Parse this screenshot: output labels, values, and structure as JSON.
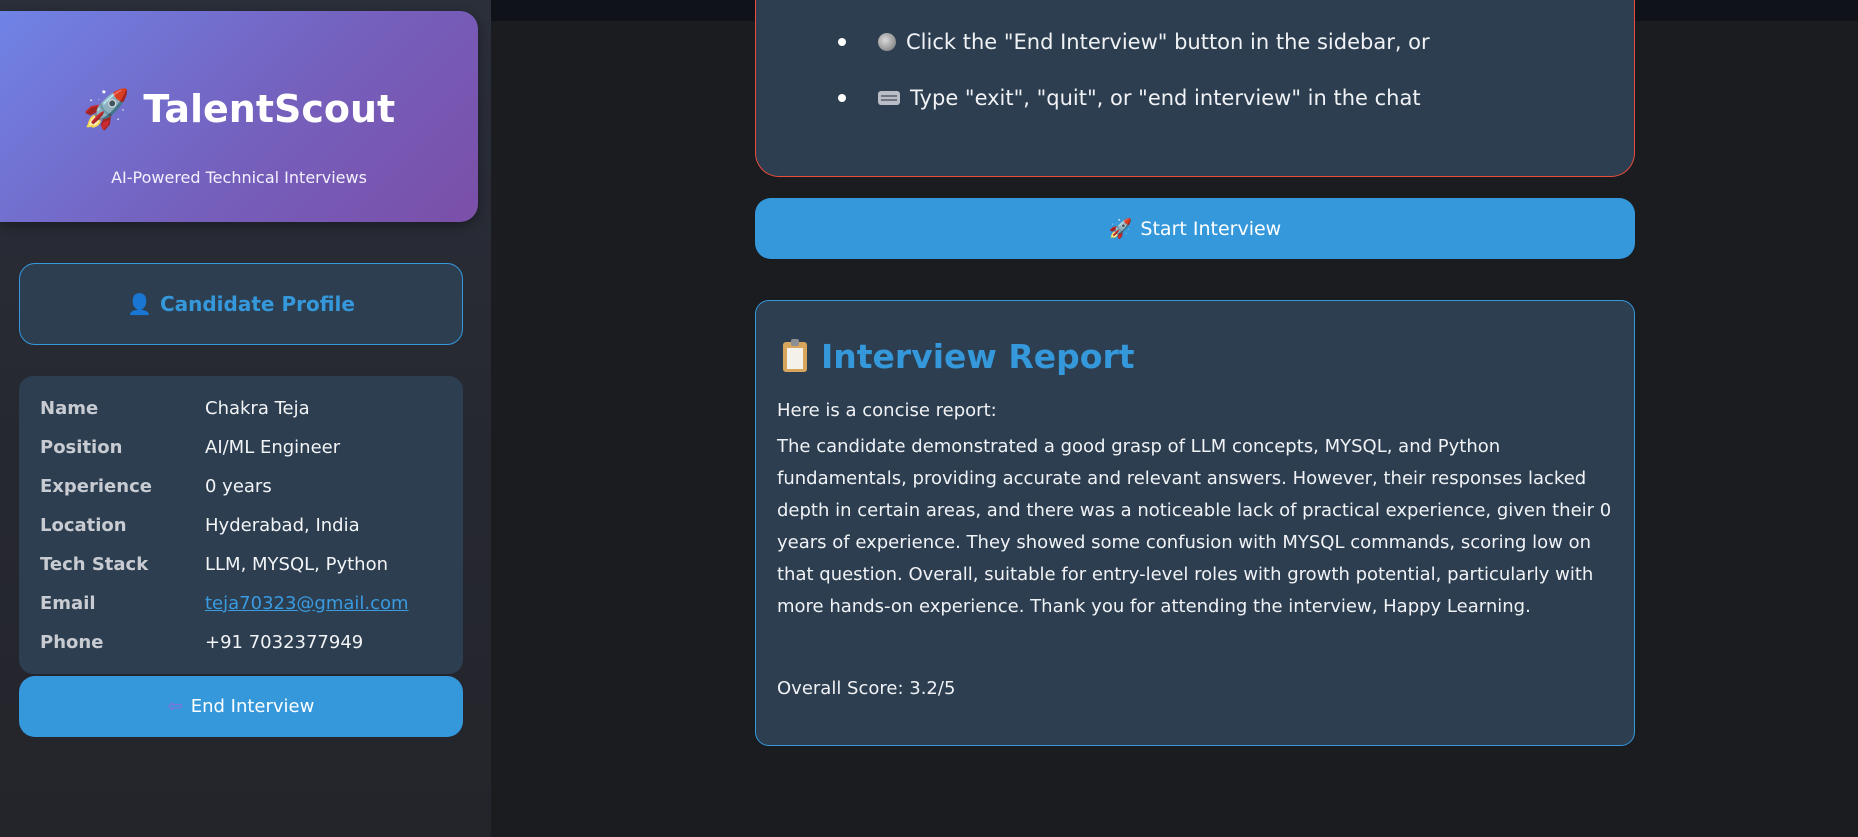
{
  "sidebar": {
    "brand_title": "TalentScout",
    "brand_icon": "rocket-icon",
    "brand_subtitle": "AI-Powered Technical Interviews",
    "profile_heading": "Candidate Profile",
    "profile_icon": "person-icon",
    "profile": [
      {
        "label": "Name",
        "value": "Chakra Teja"
      },
      {
        "label": "Position",
        "value": "AI/ML Engineer"
      },
      {
        "label": "Experience",
        "value": "0 years"
      },
      {
        "label": "Location",
        "value": "Hyderabad, India"
      },
      {
        "label": "Tech Stack",
        "value": "LLM, MYSQL, Python"
      },
      {
        "label": "Email",
        "value": "teja70323@gmail.com"
      },
      {
        "label": "Phone",
        "value": "+91 7032377949"
      }
    ],
    "end_button_label": "End Interview",
    "end_button_icon": "exit-icon"
  },
  "instructions": {
    "items": [
      {
        "icon": "radio-button-icon",
        "text": "Click the \"End Interview\" button in the sidebar, or"
      },
      {
        "icon": "keyboard-icon",
        "text": "Type \"exit\", \"quit\", or \"end interview\" in the chat"
      }
    ]
  },
  "start_button_label": "Start Interview",
  "start_button_icon": "rocket-icon",
  "report": {
    "icon": "clipboard-icon",
    "title": "Interview Report",
    "intro": "Here is a concise report:",
    "body": "The candidate demonstrated a good grasp of LLM concepts, MYSQL, and Python fundamentals, providing accurate and relevant answers. However, their responses lacked depth in certain areas, and there was a noticeable lack of practical experience, given their 0 years of experience. They showed some confusion with MYSQL commands, scoring low on that question. Overall, suitable for entry-level roles with growth potential, particularly with more hands-on experience. Thank you for attending the interview, Happy Learning.",
    "score": "Overall Score: 3.2/5"
  },
  "colors": {
    "accent": "#3498db",
    "card": "#2c3e50",
    "warning_border": "#e74c3c",
    "background": "#1a1c20"
  }
}
